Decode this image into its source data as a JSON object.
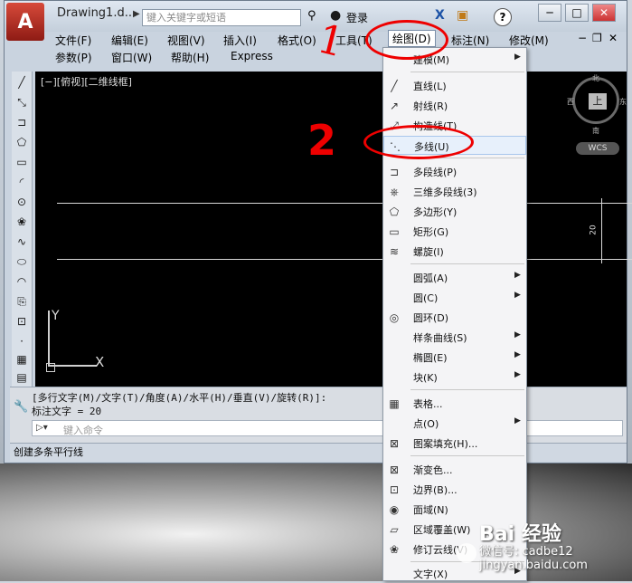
{
  "title_bar": {
    "doc_title": "Drawing1.d...",
    "search_placeholder": "键入关键字或短语",
    "login_label": "登录",
    "help_label": "?",
    "win_min": "─",
    "win_max": "□",
    "win_close": "✕",
    "app_letter": "A"
  },
  "menubar": {
    "row1": [
      "文件(F)",
      "编辑(E)",
      "视图(V)",
      "插入(I)",
      "格式(O)",
      "工具(T)",
      "绘图(D)",
      "标注(N)",
      "修改(M)"
    ],
    "row2": [
      "参数(P)",
      "窗口(W)",
      "帮助(H)",
      "Express"
    ],
    "active": "绘图(D)"
  },
  "viewport": {
    "label": "[−][俯视][二维线框]",
    "dim_value": "20",
    "ucs_x": "X",
    "ucs_y": "Y"
  },
  "viewcube": {
    "top": "上",
    "north": "北",
    "south": "南",
    "west": "西",
    "east": "东",
    "wcs": "WCS"
  },
  "command": {
    "history": [
      "[多行文字(M)/文字(T)/角度(A)/水平(H)/垂直(V)/旋转(R)]:",
      "标注文字 = 20"
    ],
    "placeholder": "键入命令"
  },
  "status": {
    "text": "创建多条平行线"
  },
  "draw_menu": {
    "items": [
      {
        "label": "建模(M)",
        "icon": "",
        "submenu": true
      },
      {
        "label": "直线(L)",
        "icon": "line-icon",
        "submenu": false
      },
      {
        "label": "射线(R)",
        "icon": "ray-icon",
        "submenu": false
      },
      {
        "label": "构造线(T)",
        "icon": "xline-icon",
        "submenu": false
      },
      {
        "label": "多线(U)",
        "icon": "mline-icon",
        "submenu": false,
        "highlighted": true
      },
      {
        "label": "多段线(P)",
        "icon": "polyline-icon",
        "submenu": false
      },
      {
        "label": "三维多段线(3)",
        "icon": "3dpoly-icon",
        "submenu": false
      },
      {
        "label": "多边形(Y)",
        "icon": "polygon-icon",
        "submenu": false
      },
      {
        "label": "矩形(G)",
        "icon": "rectangle-icon",
        "submenu": false
      },
      {
        "label": "螺旋(I)",
        "icon": "helix-icon",
        "submenu": false
      },
      {
        "label": "圆弧(A)",
        "icon": "",
        "submenu": true
      },
      {
        "label": "圆(C)",
        "icon": "",
        "submenu": true
      },
      {
        "label": "圆环(D)",
        "icon": "donut-icon",
        "submenu": false
      },
      {
        "label": "样条曲线(S)",
        "icon": "",
        "submenu": true
      },
      {
        "label": "椭圆(E)",
        "icon": "",
        "submenu": true
      },
      {
        "label": "块(K)",
        "icon": "",
        "submenu": true
      },
      {
        "label": "表格...",
        "icon": "table-icon",
        "submenu": false
      },
      {
        "label": "点(O)",
        "icon": "",
        "submenu": true
      },
      {
        "label": "图案填充(H)...",
        "icon": "hatch-icon",
        "submenu": false
      },
      {
        "label": "渐变色...",
        "icon": "gradient-icon",
        "submenu": false
      },
      {
        "label": "边界(B)...",
        "icon": "boundary-icon",
        "submenu": false
      },
      {
        "label": "面域(N)",
        "icon": "region-icon",
        "submenu": false
      },
      {
        "label": "区域覆盖(W)",
        "icon": "wipeout-icon",
        "submenu": false
      },
      {
        "label": "修订云线(V)",
        "icon": "revcloud-icon",
        "submenu": false
      },
      {
        "label": "文字(X)",
        "icon": "",
        "submenu": true
      }
    ]
  },
  "annotations": {
    "step1": "1",
    "step2": "2"
  },
  "watermark": {
    "brand": "Bai 经验",
    "sub": "微信号: cadbe12",
    "site": "jingyan.baidu.com"
  }
}
